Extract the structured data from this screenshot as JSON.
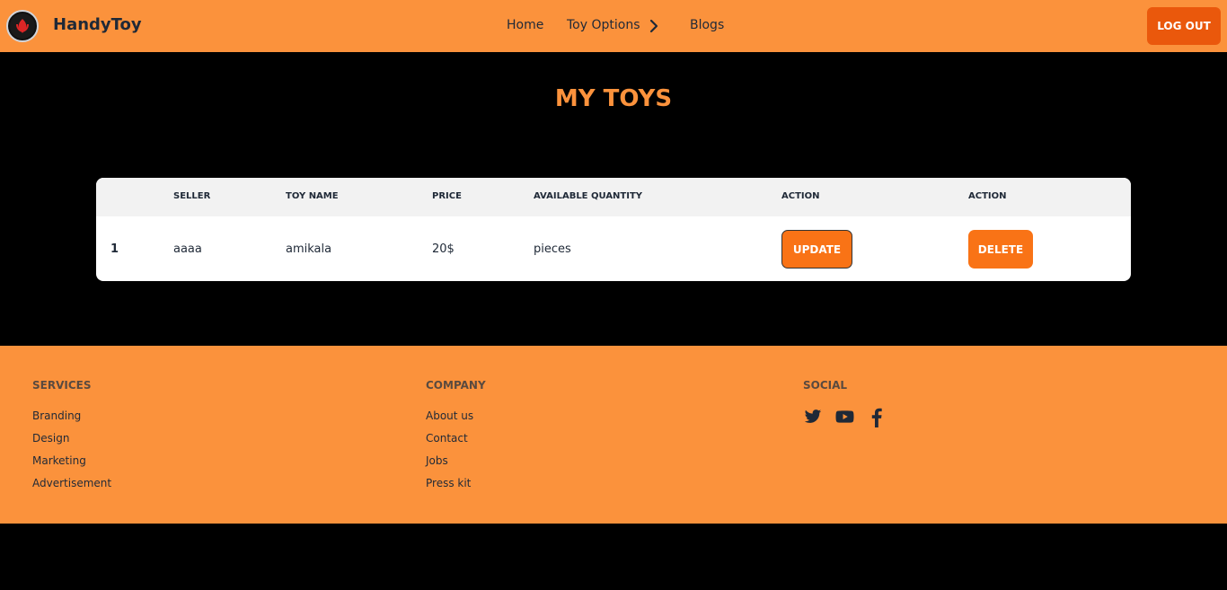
{
  "header": {
    "brand": "HandyToy",
    "nav": {
      "home": "Home",
      "toy_options": "Toy Options",
      "blogs": "Blogs"
    },
    "logout_label": "LOG OUT"
  },
  "page": {
    "title": "MY TOYS"
  },
  "table": {
    "columns": [
      "",
      "SELLER",
      "TOY NAME",
      "PRICE",
      "AVAILABLE QUANTITY",
      "ACTION",
      "ACTION"
    ],
    "rows": [
      {
        "index": "1",
        "seller": "aaaa",
        "toy_name": "amikala",
        "price": "20$",
        "quantity": "pieces",
        "update_label": "UPDATE",
        "delete_label": "DELETE"
      }
    ]
  },
  "footer": {
    "services": {
      "heading": "SERVICES",
      "links": [
        "Branding",
        "Design",
        "Marketing",
        "Advertisement"
      ]
    },
    "company": {
      "heading": "COMPANY",
      "links": [
        "About us",
        "Contact",
        "Jobs",
        "Press kit"
      ]
    },
    "social": {
      "heading": "SOCIAL",
      "icons": [
        "twitter-icon",
        "youtube-icon",
        "facebook-icon"
      ]
    }
  },
  "colors": {
    "accent": "#fb923c",
    "button": "#f97316",
    "logout": "#ea580c",
    "background": "#000000"
  }
}
